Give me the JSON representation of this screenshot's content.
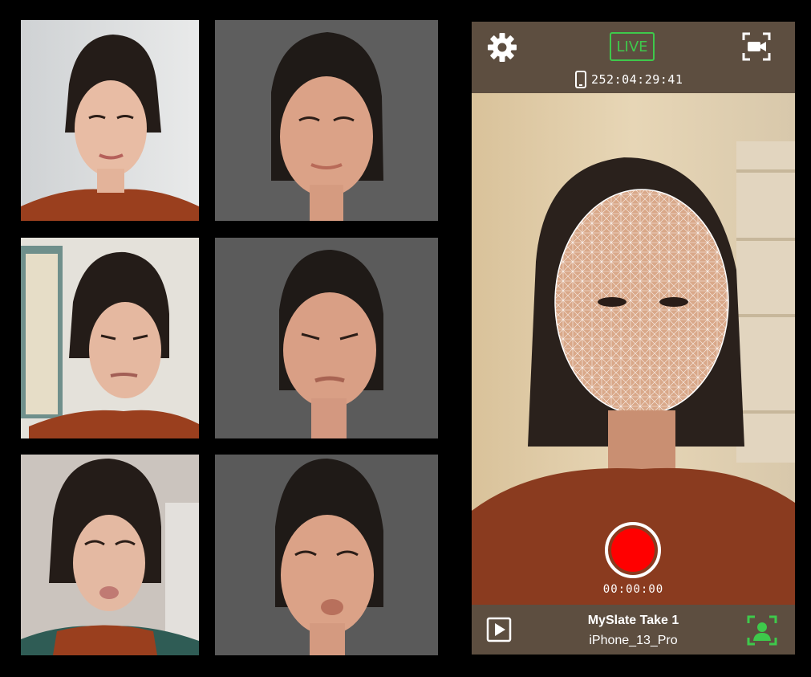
{
  "topbar": {
    "live_label": "LIVE",
    "timecode": "252:04:29:41",
    "icons": [
      "gear-icon",
      "switch-camera-icon",
      "phone-device-icon"
    ]
  },
  "recording": {
    "elapsed": "00:00:00"
  },
  "slate": {
    "title": "MySlate Take 1",
    "device": "iPhone_13_Pro"
  },
  "bottombar": {
    "icons": [
      "play-icon",
      "face-tracking-icon"
    ]
  },
  "colors": {
    "accent_green": "#3ec94b",
    "record_red": "#ff0000",
    "bar_brown": "#5d4e40"
  }
}
